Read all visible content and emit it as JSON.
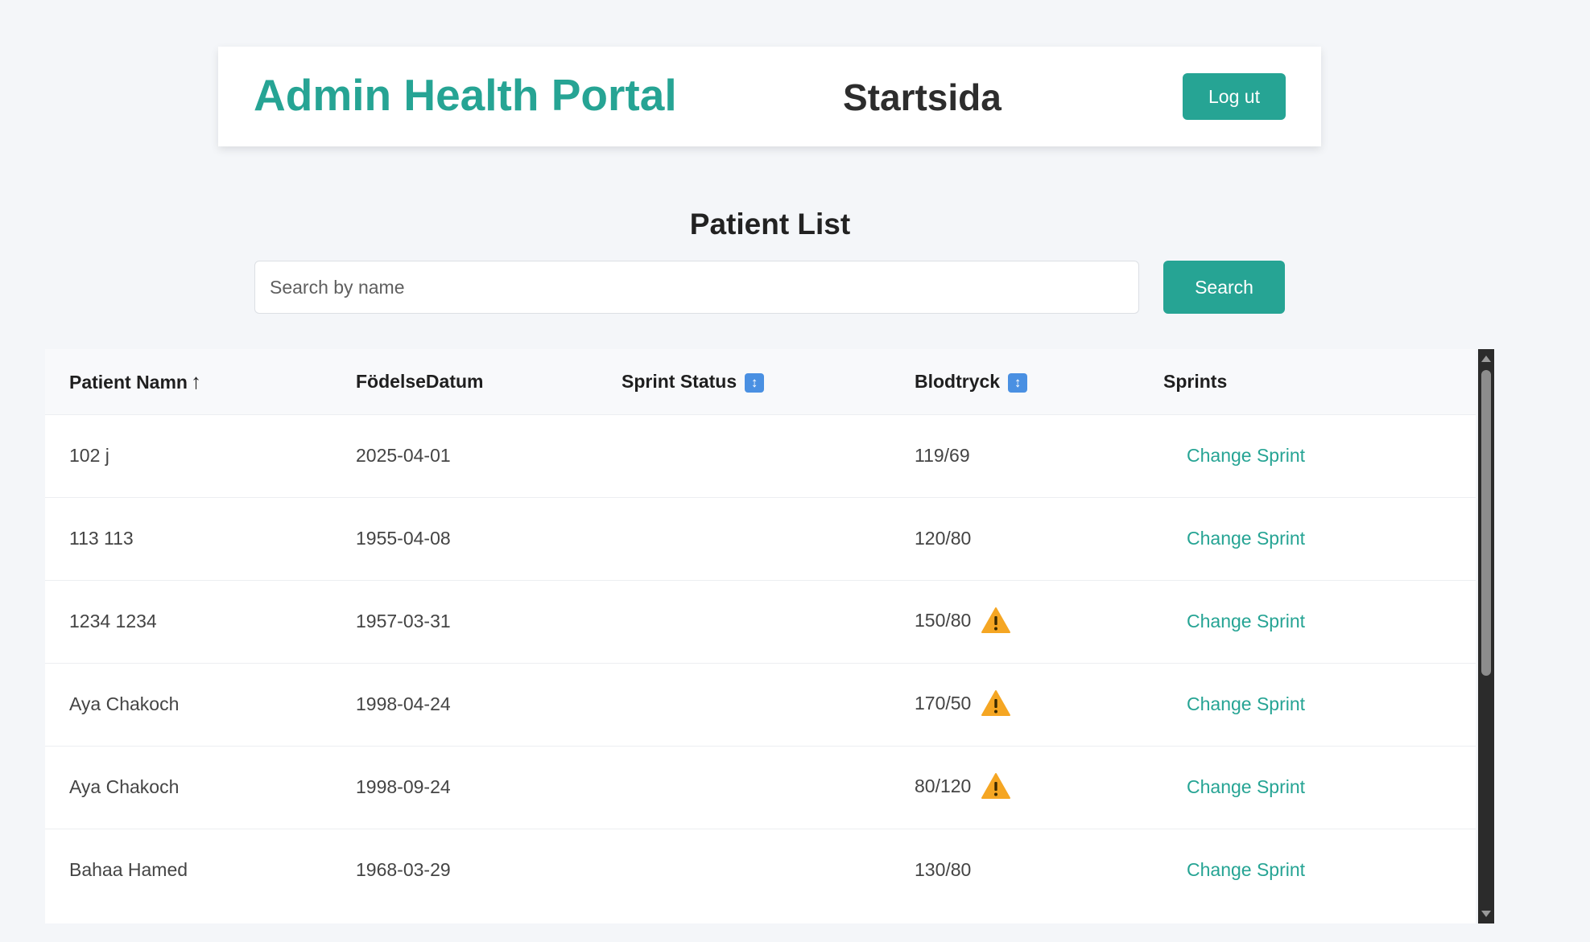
{
  "header": {
    "brand": "Admin Health Portal",
    "page_title": "Startsida",
    "logout_label": "Log ut"
  },
  "main": {
    "title": "Patient List",
    "search_placeholder": "Search by name",
    "search_label": "Search"
  },
  "table": {
    "columns": {
      "name": "Patient Namn",
      "name_sort": "↑",
      "dob": "FödelseDatum",
      "sprint_status": "Sprint Status",
      "blood_pressure": "Blodtryck",
      "sprints": "Sprints"
    },
    "sort_icon": "up-down-arrow-icon",
    "rows": [
      {
        "name": "102 j",
        "dob": "2025-04-01",
        "sprint_status": "",
        "bp": "119/69",
        "warning": false,
        "action": "Change Sprint"
      },
      {
        "name": "113 113",
        "dob": "1955-04-08",
        "sprint_status": "",
        "bp": "120/80",
        "warning": false,
        "action": "Change Sprint"
      },
      {
        "name": "1234 1234",
        "dob": "1957-03-31",
        "sprint_status": "",
        "bp": "150/80",
        "warning": true,
        "action": "Change Sprint"
      },
      {
        "name": "Aya Chakoch",
        "dob": "1998-04-24",
        "sprint_status": "",
        "bp": "170/50",
        "warning": true,
        "action": "Change Sprint"
      },
      {
        "name": "Aya Chakoch",
        "dob": "1998-09-24",
        "sprint_status": "",
        "bp": "80/120",
        "warning": true,
        "action": "Change Sprint"
      },
      {
        "name": "Bahaa Hamed",
        "dob": "1968-03-29",
        "sprint_status": "",
        "bp": "130/80",
        "warning": false,
        "action": "Change Sprint"
      }
    ]
  },
  "colors": {
    "accent": "#26a494",
    "warning": "#f5a623",
    "sort_icon": "#4a90e2"
  }
}
